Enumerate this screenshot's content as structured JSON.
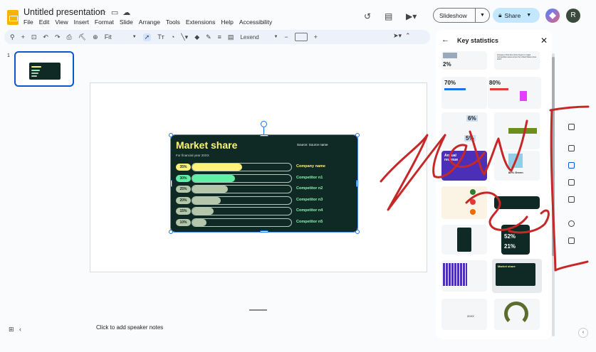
{
  "app": {
    "doc_title": "Untitled presentation",
    "menu": [
      "File",
      "Edit",
      "View",
      "Insert",
      "Format",
      "Slide",
      "Arrange",
      "Tools",
      "Extensions",
      "Help",
      "Accessibility"
    ],
    "slideshow_label": "Slideshow",
    "share_label": "Share",
    "avatar_initial": "R"
  },
  "toolbar": {
    "zoom_label": "Fit",
    "font_name": "Lexend",
    "icons": [
      "search-icon",
      "add-icon",
      "new-slide-icon",
      "undo-icon",
      "redo-icon",
      "print-icon",
      "paint-format-icon",
      "zoom-icon",
      "select-icon",
      "text-box-icon",
      "shape-icon",
      "line-icon",
      "fill-color-icon",
      "border-color-icon",
      "border-weight-icon",
      "border-dash-icon"
    ]
  },
  "filmstrip": {
    "slide_number": "1"
  },
  "slide": {
    "title": "Market share",
    "subtitle": "For financial year 20XX",
    "source": "Source: Source name",
    "bars": [
      {
        "pct": "35%",
        "name": "Company name",
        "value": 35,
        "color": "#fff27a"
      },
      {
        "pct": "30%",
        "name": "Competitor n1",
        "value": 30,
        "color": "#5ff0a5"
      },
      {
        "pct": "25%",
        "name": "Competitor n2",
        "value": 25,
        "color": "#b5c7aa"
      },
      {
        "pct": "20%",
        "name": "Competitor n3",
        "value": 20,
        "color": "#b5c7aa"
      },
      {
        "pct": "15%",
        "name": "Competitor n4",
        "value": 15,
        "color": "#b5c7aa"
      },
      {
        "pct": "10%",
        "name": "Competitor n5",
        "value": 10,
        "color": "#b5c7aa"
      }
    ]
  },
  "notes": {
    "placeholder": "Click to add speaker notes"
  },
  "side_panel": {
    "title": "Key statistics",
    "tiles": [
      {
        "label": "2%"
      },
      {
        "label": "Increase in first-time home buyers in major metropolitan areas across the United States since 20XX"
      },
      {
        "label": "70%"
      },
      {
        "label": "80%"
      },
      {
        "label": "6%"
      },
      {
        "label": "5%"
      },
      {
        "label": "Annual revenue"
      },
      {
        "label": "80% Green"
      },
      {
        "label": "52%"
      },
      {
        "label": "21%"
      },
      {
        "label": "Market share"
      },
      {
        "label": "20XX"
      }
    ]
  },
  "colors": {
    "accent": "#0b57d0",
    "ink": "#c62828",
    "slide_bg": "#0f2a24"
  }
}
